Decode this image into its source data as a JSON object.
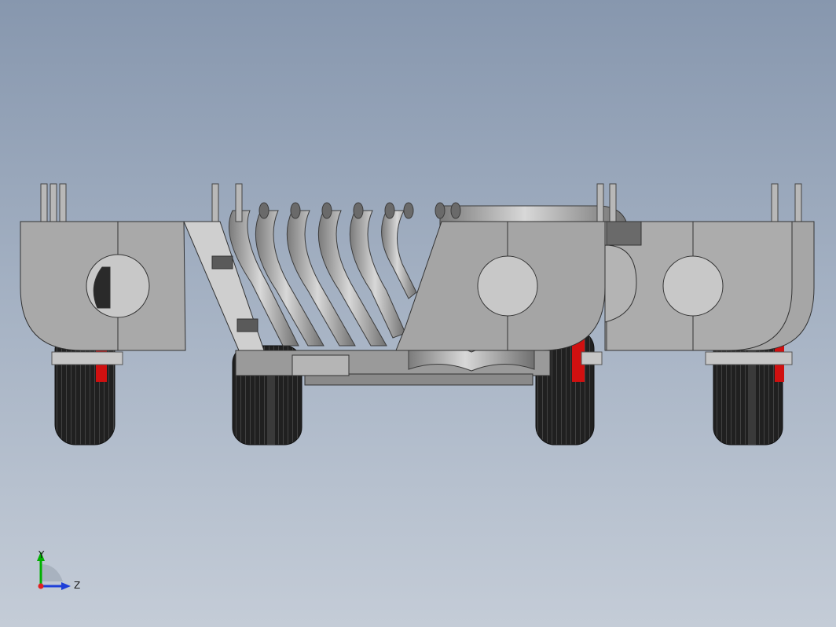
{
  "viewport": {
    "background_top": "#8797ae",
    "background_bottom": "#c4ccd7"
  },
  "model": {
    "icon": "cad-assembly-front-view",
    "part_color": "#a9a9a9",
    "tire_color": "#1e1e1e",
    "rim_color": "#d01010"
  },
  "triad": {
    "x_label": "Y",
    "z_label": "Z",
    "y_color": "#00b000",
    "z_color": "#1e3fd8",
    "origin_color": "#e02020"
  }
}
